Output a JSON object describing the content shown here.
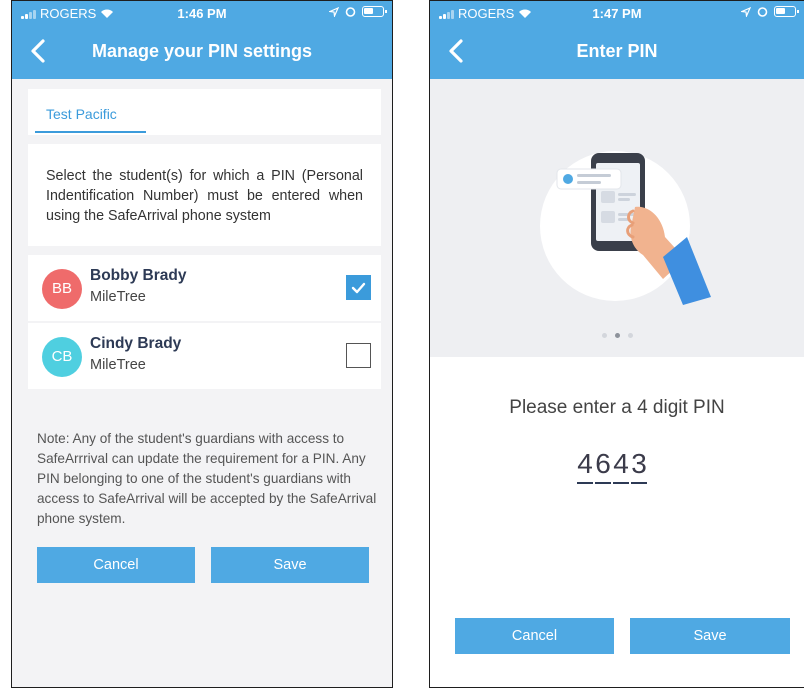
{
  "left": {
    "status": {
      "carrier": "ROGERS",
      "time": "1:46 PM"
    },
    "title": "Manage your PIN settings",
    "tab": "Test Pacific",
    "instructions": "Select the student(s) for which a PIN (Personal Indentification Number) must be entered when using the SafeArrival phone system",
    "students": [
      {
        "initials": "BB",
        "name": "Bobby Brady",
        "school": "MileTree",
        "checked": true,
        "color": "#ef6b6b"
      },
      {
        "initials": "CB",
        "name": "Cindy Brady",
        "school": "MileTree",
        "checked": false,
        "color": "#4fcfe0"
      }
    ],
    "note": "Note: Any of the student's guardians with access to SafeArrrival can update the requirement for a PIN. Any PIN belonging to one of the student's guardians with access to SafeArrival will be accepted by the SafeArrival phone system.",
    "cancel_label": "Cancel",
    "save_label": "Save"
  },
  "right": {
    "status": {
      "carrier": "ROGERS",
      "time": "1:47 PM"
    },
    "title": "Enter PIN",
    "prompt": "Please enter a 4 digit PIN",
    "pin_digits": [
      "4",
      "6",
      "4",
      "3"
    ],
    "carousel": {
      "count": 3,
      "active_index": 1
    },
    "cancel_label": "Cancel",
    "save_label": "Save"
  },
  "colors": {
    "accent": "#4fa9e3",
    "link": "#3b9bdb"
  },
  "icons": [
    "back-chevron-icon",
    "wifi-icon",
    "location-arrow-icon",
    "alarm-icon",
    "battery-icon",
    "checkmark-icon",
    "phone-hand-illustration"
  ]
}
